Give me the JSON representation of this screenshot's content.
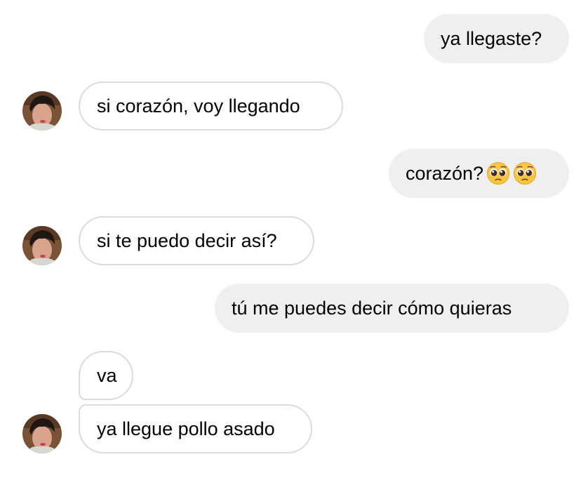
{
  "conversation": {
    "messages": [
      {
        "direction": "outgoing",
        "text": "ya llegaste?"
      },
      {
        "direction": "incoming",
        "text": "si corazón, voy llegando"
      },
      {
        "direction": "outgoing",
        "text": "corazón?",
        "emojis": [
          "pleading-face-emoji",
          "pleading-face-emoji"
        ]
      },
      {
        "direction": "incoming",
        "text": "si te puedo decir así?"
      },
      {
        "direction": "outgoing",
        "text": "tú me puedes decir cómo quieras"
      },
      {
        "direction": "incoming",
        "text": "va"
      },
      {
        "direction": "incoming",
        "text": "ya llegue pollo asado"
      }
    ]
  },
  "colors": {
    "outgoing_bubble": "#efefef",
    "incoming_border": "#dbdbdb",
    "text": "#000000"
  }
}
